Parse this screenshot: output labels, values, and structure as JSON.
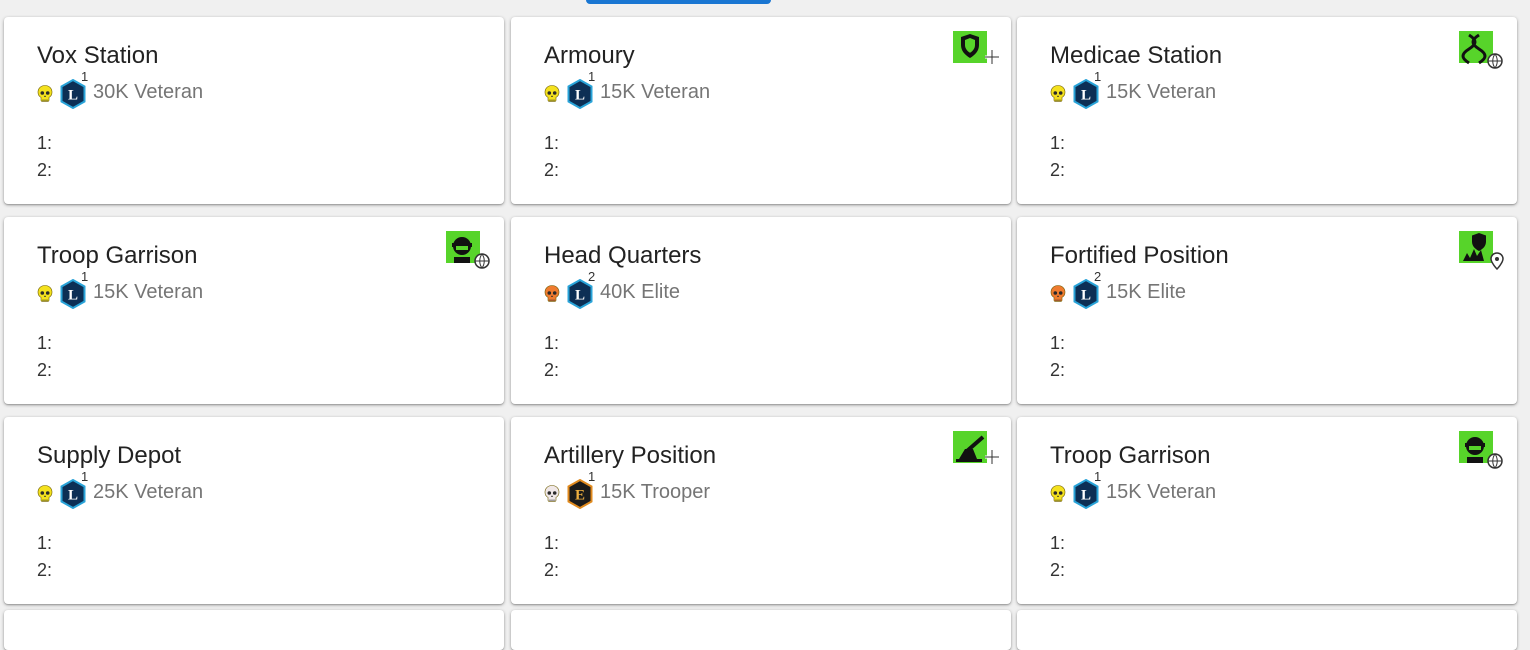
{
  "cards": [
    {
      "title": "Vox Station",
      "skull_color": "#f4e11e",
      "rank": "L",
      "rank_level": "1",
      "text": "30K Veteran",
      "slot1": "1:",
      "slot2": "2:",
      "bonus_icon": ""
    },
    {
      "title": "Armoury",
      "skull_color": "#f4e11e",
      "rank": "L",
      "rank_level": "1",
      "text": "15K Veteran",
      "slot1": "1:",
      "slot2": "2:",
      "bonus_icon": "shield-plus-icon"
    },
    {
      "title": "Medicae Station",
      "skull_color": "#f4e11e",
      "rank": "L",
      "rank_level": "1",
      "text": "15K Veteran",
      "slot1": "1:",
      "slot2": "2:",
      "bonus_icon": "dna-globe-icon"
    },
    {
      "title": "Troop Garrison",
      "skull_color": "#f4e11e",
      "rank": "L",
      "rank_level": "1",
      "text": "15K Veteran",
      "slot1": "1:",
      "slot2": "2:",
      "bonus_icon": "trooper-globe-icon"
    },
    {
      "title": "Head Quarters",
      "skull_color": "#ef7b2f",
      "rank": "L",
      "rank_level": "2",
      "text": "40K Elite",
      "slot1": "1:",
      "slot2": "2:",
      "bonus_icon": ""
    },
    {
      "title": "Fortified Position",
      "skull_color": "#ef7b2f",
      "rank": "L",
      "rank_level": "2",
      "text": "15K Elite",
      "slot1": "1:",
      "slot2": "2:",
      "bonus_icon": "shield-blast-pin-icon"
    },
    {
      "title": "Supply Depot",
      "skull_color": "#f4e11e",
      "rank": "L",
      "rank_level": "1",
      "text": "25K Veteran",
      "slot1": "1:",
      "slot2": "2:",
      "bonus_icon": ""
    },
    {
      "title": "Artillery Position",
      "skull_color": "#f0e8e8",
      "rank": "E",
      "rank_level": "1",
      "text": "15K Trooper",
      "slot1": "1:",
      "slot2": "2:",
      "bonus_icon": "artillery-plus-icon"
    },
    {
      "title": "Troop Garrison",
      "skull_color": "#f4e11e",
      "rank": "L",
      "rank_level": "1",
      "text": "15K Veteran",
      "slot1": "1:",
      "slot2": "2:",
      "bonus_icon": "trooper-globe-icon"
    }
  ],
  "colors": {
    "rank_L_fill": "#0d2f55",
    "rank_L_stroke": "#29a3d8",
    "rank_E_fill": "#1b1b1b",
    "rank_E_stroke": "#e08a1e",
    "bonus_bg": "#57d42a",
    "accent": "#1976d2"
  }
}
